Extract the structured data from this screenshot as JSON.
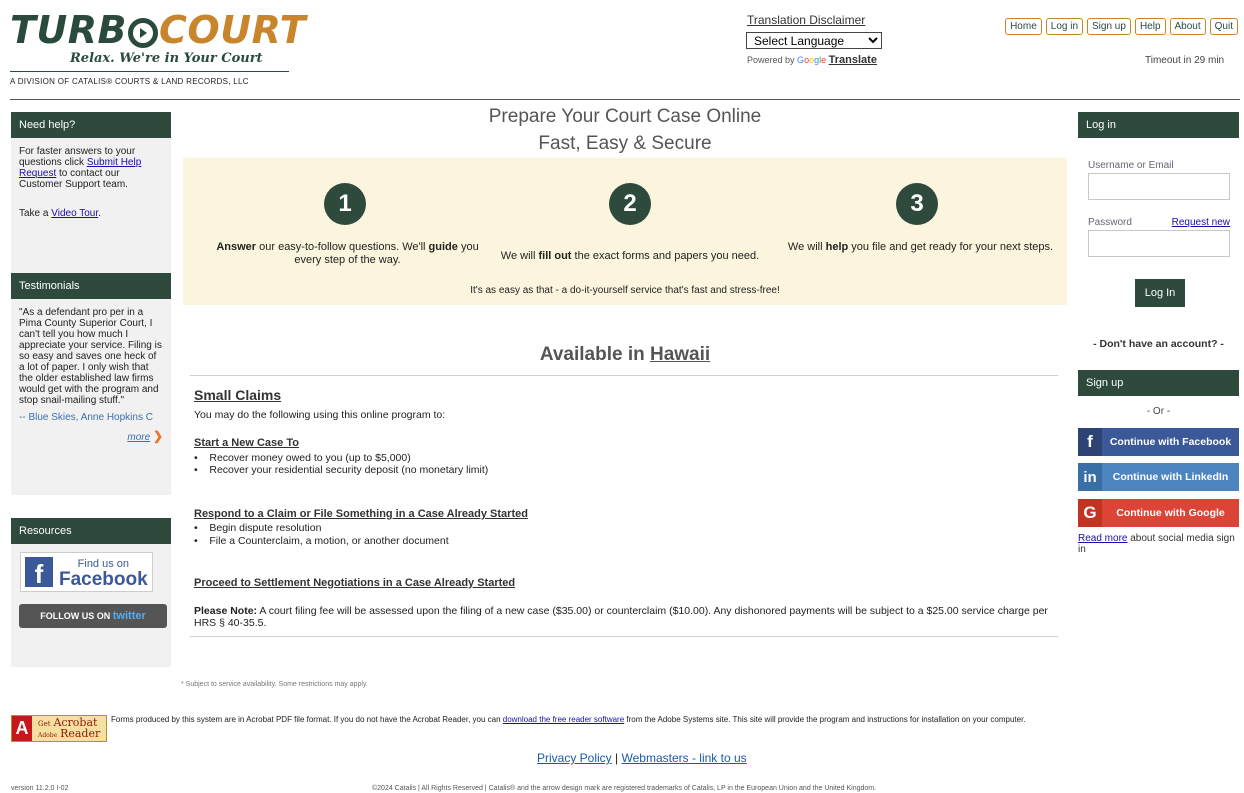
{
  "brand": {
    "logo_turbo": "TURB",
    "logo_court": "COURT",
    "tagline": "Relax. We're in Your Court",
    "division": "A DIVISION OF CATALIS® COURTS & LAND RECORDS, LLC"
  },
  "translation": {
    "disclaimer": "Translation Disclaimer",
    "selected_language": "Select Language",
    "powered_by": "Powered by",
    "google_parts": [
      "G",
      "o",
      "o",
      "g",
      "l",
      "e"
    ],
    "translate": "Translate"
  },
  "topnav": {
    "home": "Home",
    "login": "Log in",
    "signup": "Sign up",
    "help": "Help",
    "about": "About",
    "quit": "Quit"
  },
  "timeout": "Timeout in 29 min",
  "left": {
    "need_help": {
      "header": "Need help?",
      "text_before": "For faster answers to your questions click",
      "link": "Submit Help Request",
      "text_after": "to contact our Customer Support team.",
      "tour_before": "Take a",
      "tour_link": "Video Tour",
      "tour_after": "."
    },
    "testimonials": {
      "header": "Testimonials",
      "quote": "\"As a defendant pro per in a Pima County Superior Court, I can't tell you how much I appreciate your service. Filing is so easy and saves one heck of a lot of paper. I only wish that the older established law firms would get with the program and stop snail-mailing stuff.\"",
      "author": "-- Blue Skies, Anne Hopkins C",
      "more": "more"
    },
    "resources": {
      "header": "Resources",
      "facebook_top": "Find us on",
      "facebook_bottom": "Facebook",
      "twitter_prefix": "FOLLOW US ON",
      "twitter_brand": "twitter"
    }
  },
  "main": {
    "title_line1": "Prepare Your Court Case Online",
    "title_line2": "Fast, Easy & Secure",
    "steps": [
      {
        "number": "1",
        "b1": "Answer",
        "t1": " our easy-to-follow questions. We'll ",
        "b2": "guide",
        "t2": " you every step of the way."
      },
      {
        "number": "2",
        "t0": "We will ",
        "b1": "fill out",
        "t1": " the exact forms and papers you need."
      },
      {
        "number": "3",
        "t0": "We will ",
        "b1": "help",
        "t1": " you file and get ready for your next steps."
      }
    ],
    "tagline": "It's as easy as that - a do-it-yourself service that's fast and stress-free!",
    "available_prefix": "Available in",
    "state": "Hawaii",
    "section_title": "Small Claims",
    "intro": "You may do the following using this online program to:",
    "start_heading": "Start a New Case To",
    "start_items": [
      "Recover money owed to you (up to $5,000)",
      "Recover your residential security deposit (no monetary limit)"
    ],
    "respond_heading": "Respond to a Claim or File Something in a Case Already Started",
    "respond_items": [
      "Begin dispute resolution",
      "File a Counterclaim, a motion, or another document"
    ],
    "settlement_heading": "Proceed to Settlement Negotiations in a Case Already Started",
    "note_label": "Please Note:",
    "note_text": " A court filing fee will be assessed upon the filing of a new case ($35.00) or counterclaim ($10.00). Any dishonored payments will be subject to a $25.00 service charge per HRS § 40-35.5."
  },
  "right": {
    "login_header": "Log in",
    "username_label": "Username or Email",
    "password_label": "Password",
    "request_new": "Request new",
    "login_button": "Log In",
    "no_account": "- Don't have an account? -",
    "signup_header": "Sign up",
    "or": "- Or -",
    "facebook": "Continue with Facebook",
    "linkedin": "Continue with LinkedIn",
    "google": "Continue with Google",
    "read_more": "Read more",
    "read_more_after": " about social media sign in"
  },
  "footer": {
    "footnote": "* Subject to service availability. Some restrictions may apply.",
    "acrobat_get": "Get",
    "acrobat_name": "Acrobat",
    "acrobat_reader": "Reader",
    "acrobat_adobe": "Adobe",
    "forms_before": "Forms produced by this system are in Acrobat PDF file format. If you do not have the Acrobat Reader, you can ",
    "forms_link": "download the free reader software",
    "forms_after": " from the Adobe Systems site. This site will provide the program and instructions for installation on your computer.",
    "privacy": "Privacy Policy",
    "separator": "|",
    "webmasters": "Webmasters - link to us",
    "version": "version 11.2.0  I-02",
    "copyright": "©2024 Catalis | All Rights Reserved | Catalis® and the arrow design mark are registered trademarks of Catalis, LP in the European Union and the United Kingdom."
  },
  "colors": {
    "brand_green": "#2d4a3d",
    "brand_orange": "#c9852c",
    "facebook": "#3b5998",
    "linkedin": "#4b84be",
    "google": "#dc4437",
    "steps_bg": "#fbf5dd"
  }
}
